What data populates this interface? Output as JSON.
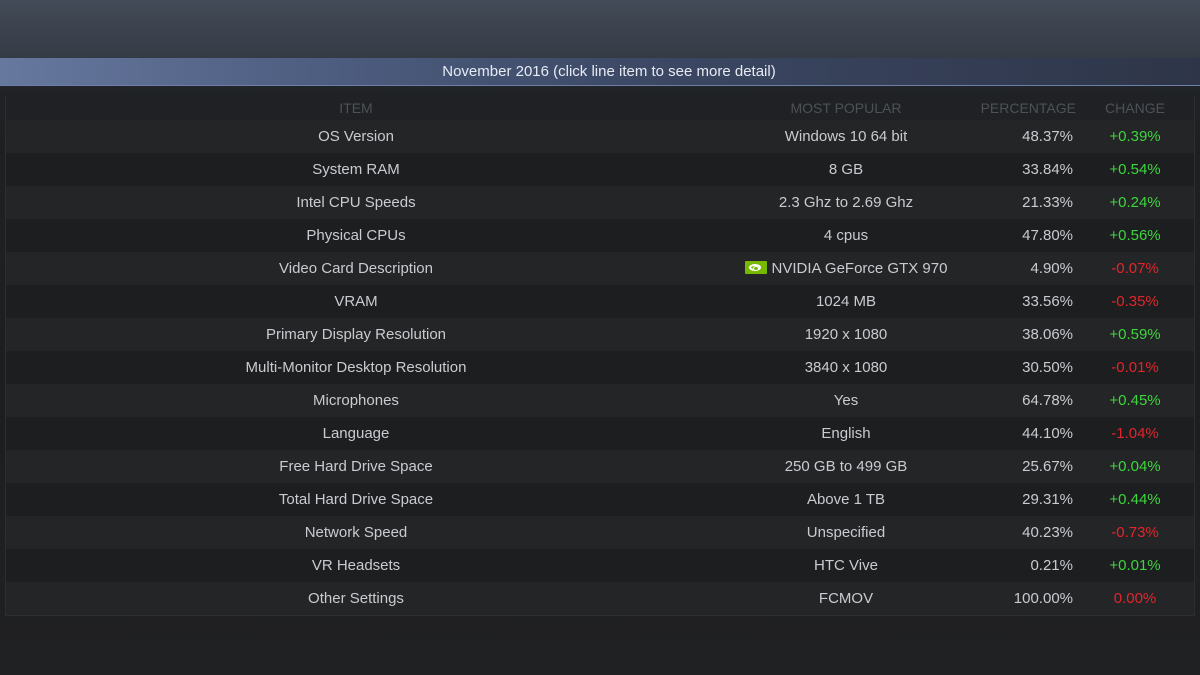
{
  "header": {
    "month_label": "November 2016 (click line item to see more detail)"
  },
  "columns": {
    "item": "ITEM",
    "most_popular": "MOST POPULAR",
    "percentage": "PERCENTAGE",
    "change": "CHANGE"
  },
  "colors": {
    "positive": "#3fd53f",
    "negative": "#e0262b",
    "nvidia_icon": "#76b900"
  },
  "rows": [
    {
      "item": "OS Version",
      "popular": "Windows 10 64 bit",
      "percentage": "48.37%",
      "change": "+0.39%",
      "trend": "pos"
    },
    {
      "item": "System RAM",
      "popular": "8 GB",
      "percentage": "33.84%",
      "change": "+0.54%",
      "trend": "pos"
    },
    {
      "item": "Intel CPU Speeds",
      "popular": "2.3 Ghz to 2.69 Ghz",
      "percentage": "21.33%",
      "change": "+0.24%",
      "trend": "pos"
    },
    {
      "item": "Physical CPUs",
      "popular": "4 cpus",
      "percentage": "47.80%",
      "change": "+0.56%",
      "trend": "pos"
    },
    {
      "item": "Video Card Description",
      "popular": "NVIDIA GeForce GTX 970",
      "percentage": "4.90%",
      "change": "-0.07%",
      "trend": "neg",
      "icon": "nvidia-logo-icon"
    },
    {
      "item": "VRAM",
      "popular": "1024 MB",
      "percentage": "33.56%",
      "change": "-0.35%",
      "trend": "neg"
    },
    {
      "item": "Primary Display Resolution",
      "popular": "1920 x 1080",
      "percentage": "38.06%",
      "change": "+0.59%",
      "trend": "pos"
    },
    {
      "item": "Multi-Monitor Desktop Resolution",
      "popular": "3840 x 1080",
      "percentage": "30.50%",
      "change": "-0.01%",
      "trend": "neg"
    },
    {
      "item": "Microphones",
      "popular": "Yes",
      "percentage": "64.78%",
      "change": "+0.45%",
      "trend": "pos"
    },
    {
      "item": "Language",
      "popular": "English",
      "percentage": "44.10%",
      "change": "-1.04%",
      "trend": "neg"
    },
    {
      "item": "Free Hard Drive Space",
      "popular": "250 GB to 499 GB",
      "percentage": "25.67%",
      "change": "+0.04%",
      "trend": "pos"
    },
    {
      "item": "Total Hard Drive Space",
      "popular": "Above 1 TB",
      "percentage": "29.31%",
      "change": "+0.44%",
      "trend": "pos"
    },
    {
      "item": "Network Speed",
      "popular": "Unspecified",
      "percentage": "40.23%",
      "change": "-0.73%",
      "trend": "neg"
    },
    {
      "item": "VR Headsets",
      "popular": "HTC Vive",
      "percentage": "0.21%",
      "change": "+0.01%",
      "trend": "pos"
    },
    {
      "item": "Other Settings",
      "popular": "FCMOV",
      "percentage": "100.00%",
      "change": "0.00%",
      "trend": "neg"
    }
  ]
}
